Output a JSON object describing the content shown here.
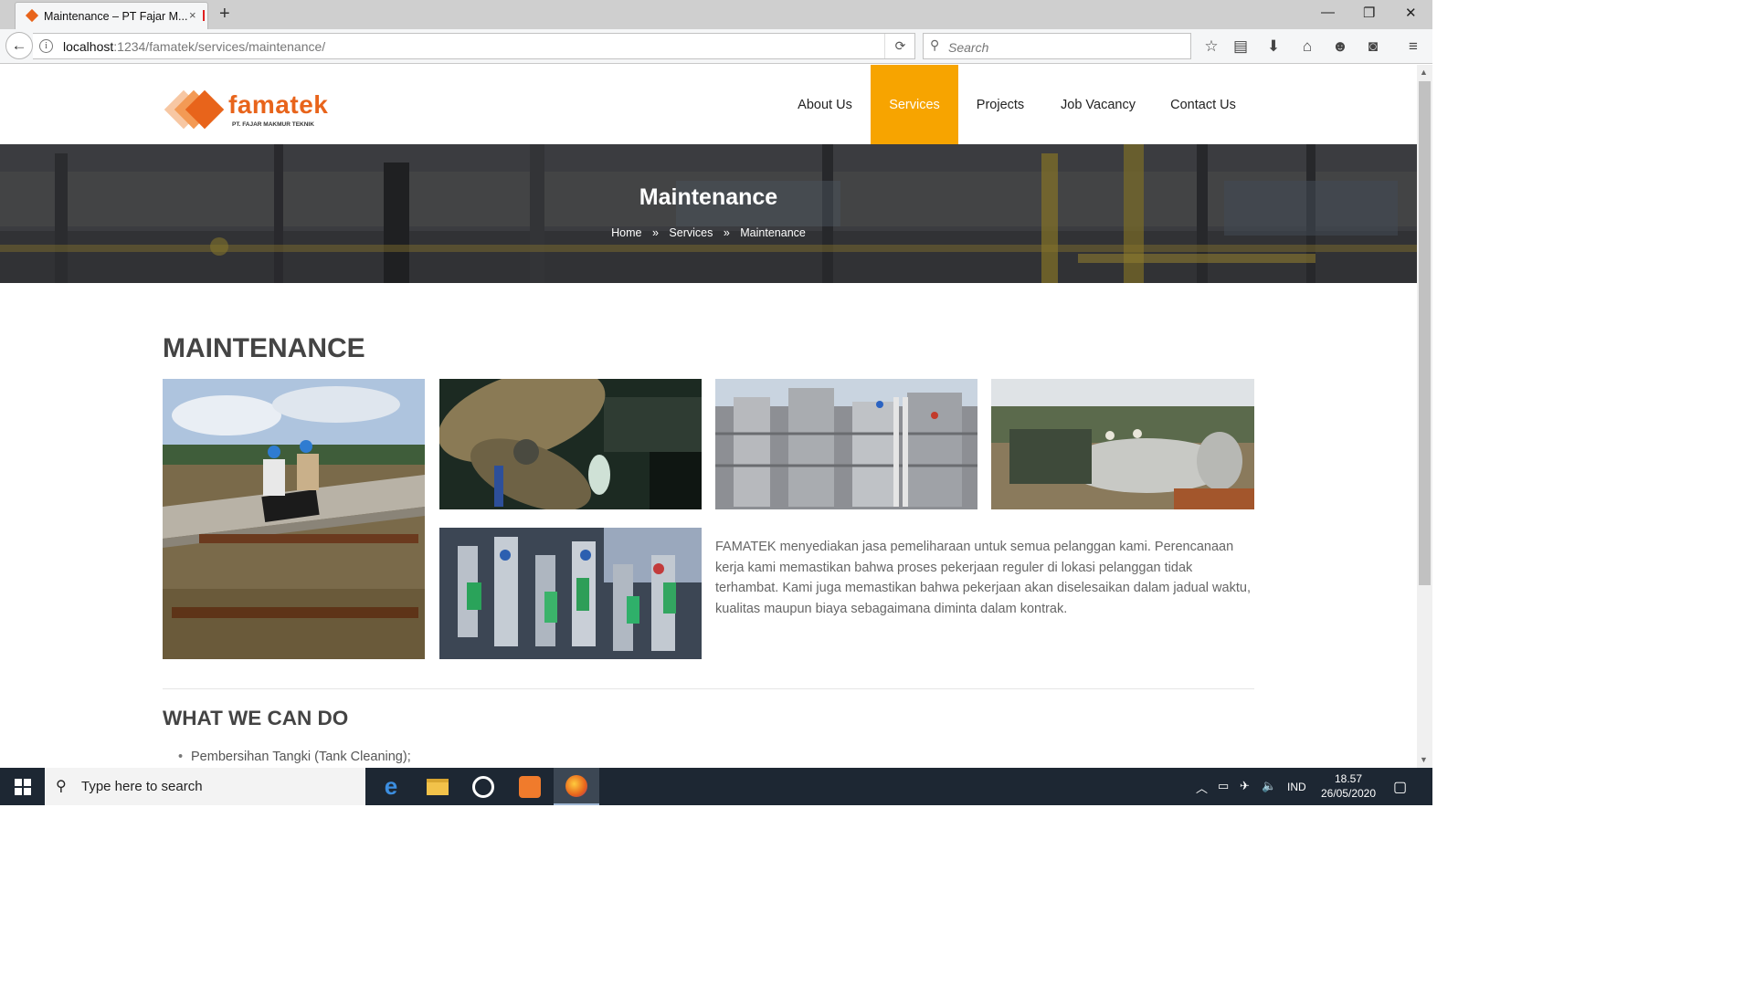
{
  "browser": {
    "tab_title": "Maintenance – PT Fajar M...",
    "tab_close": "×",
    "new_tab": "+",
    "url_host": "localhost",
    "url_rest": ":1234/famatek/services/maintenance/",
    "search_placeholder": "Search",
    "window_controls": [
      "—",
      "❐",
      "✕"
    ]
  },
  "site": {
    "logo_word": "famatek",
    "logo_sub": "PT. FAJAR MAKMUR TEKNIK",
    "menu": [
      {
        "label": "About Us"
      },
      {
        "label": "Services"
      },
      {
        "label": "Projects"
      },
      {
        "label": "Job Vacancy"
      },
      {
        "label": "Contact Us"
      }
    ],
    "active_menu": "Services",
    "accent_color": "#f7a400",
    "brand_color": "#e8641b"
  },
  "hero": {
    "title": "Maintenance",
    "breadcrumb": [
      "Home",
      "Services",
      "Maintenance"
    ],
    "separator": "»"
  },
  "main": {
    "section_title": "MAINTENANCE",
    "description": "FAMATEK menyediakan jasa pemeliharaan untuk semua pelanggan kami. Perencanaan kerja kami memastikan bahwa proses pekerjaan reguler di lokasi pelanggan tidak terhambat. Kami juga memastikan bahwa pekerjaan akan diselesaikan dalam jadual waktu, kualitas maupun biaya sebagaimana diminta dalam kontrak.",
    "what_title": "WHAT WE CAN DO",
    "services_list": [
      "Pembersihan Tangki (Tank Cleaning);"
    ]
  },
  "taskbar": {
    "search_placeholder": "Type here to search",
    "language": "IND",
    "time": "18.57",
    "date": "26/05/2020"
  }
}
